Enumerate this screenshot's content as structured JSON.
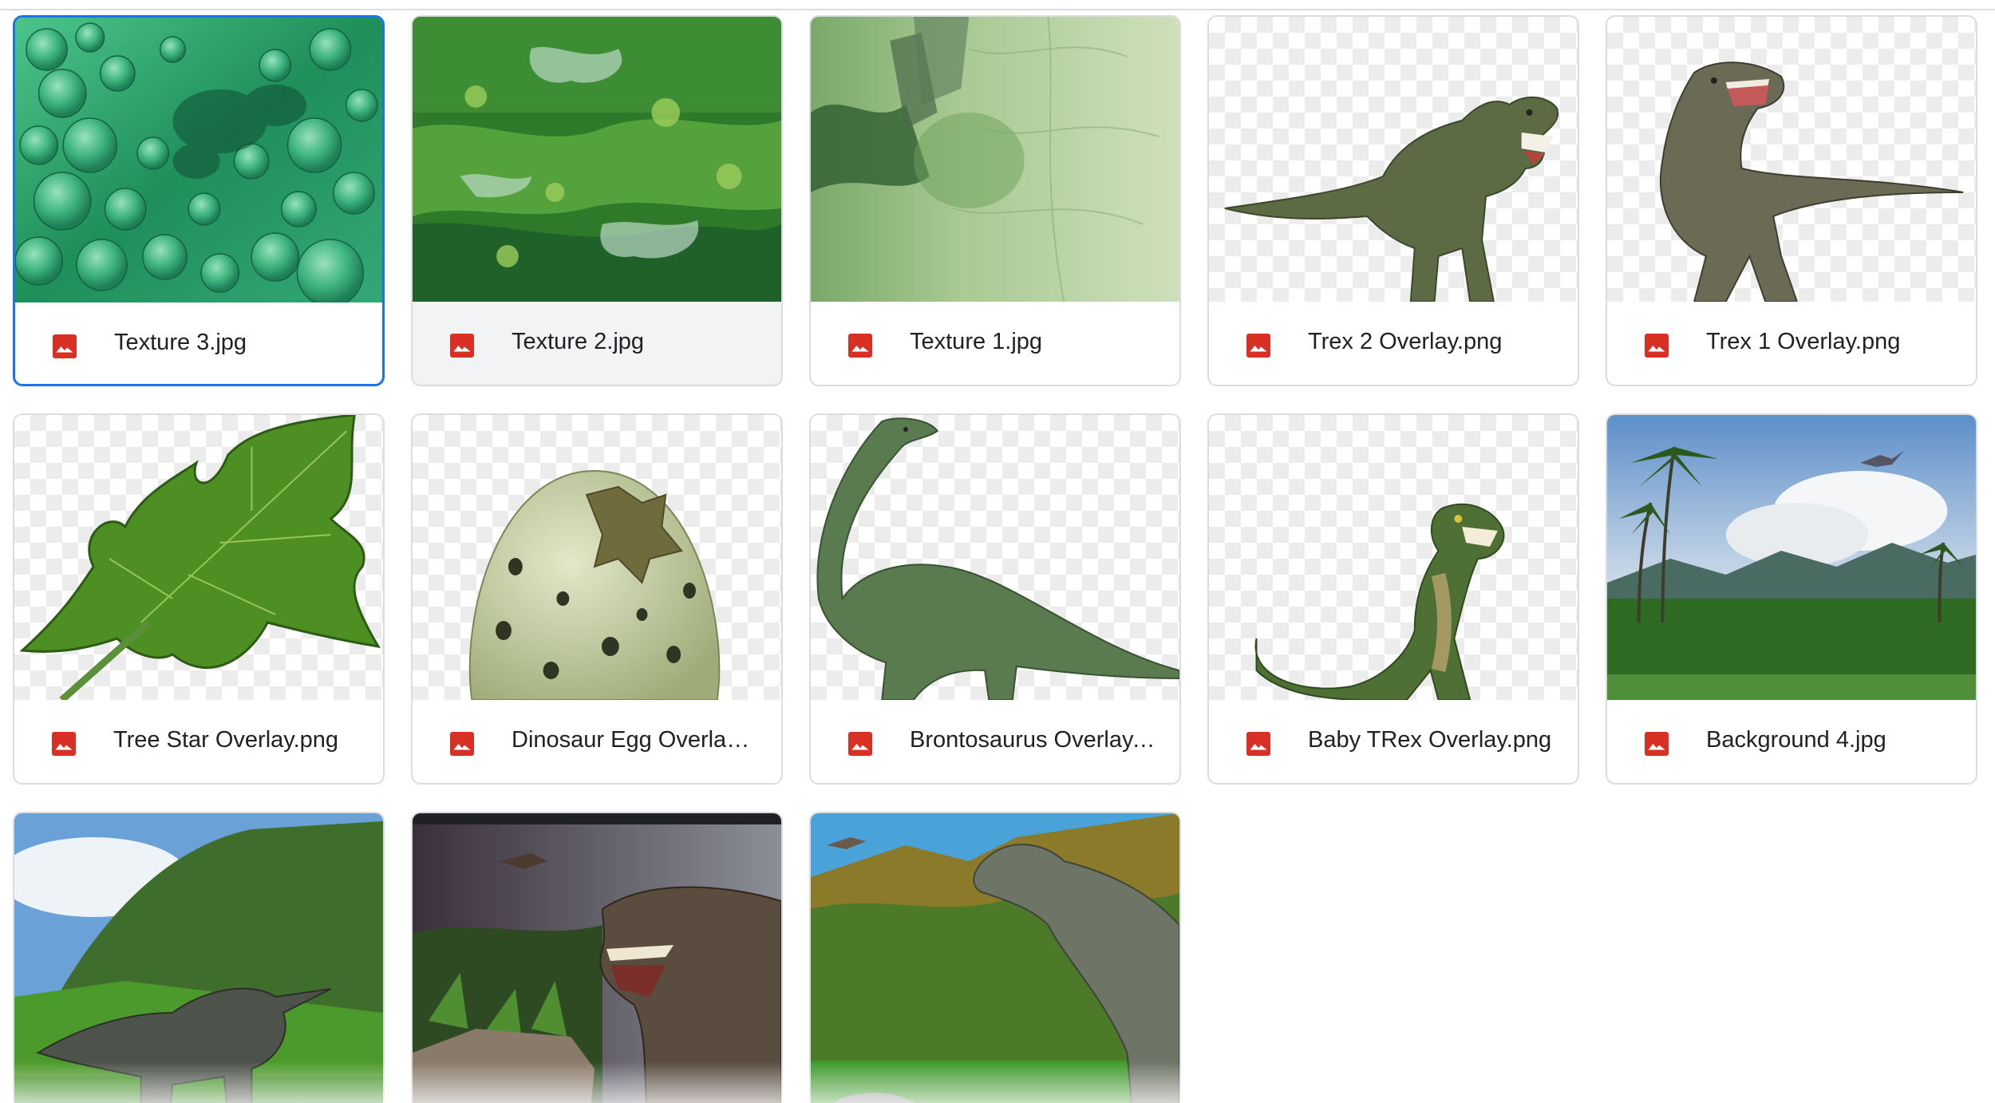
{
  "files": [
    {
      "name": "Texture 3.jpg",
      "type_icon": "image-icon",
      "state": "selected"
    },
    {
      "name": "Texture 2.jpg",
      "type_icon": "image-icon",
      "state": "hover"
    },
    {
      "name": "Texture 1.jpg",
      "type_icon": "image-icon",
      "state": "normal"
    },
    {
      "name": "Trex 2 Overlay.png",
      "type_icon": "image-icon",
      "state": "normal"
    },
    {
      "name": "Trex 1 Overlay.png",
      "type_icon": "image-icon",
      "state": "normal"
    },
    {
      "name": "Tree Star Overlay.png",
      "type_icon": "image-icon",
      "state": "normal"
    },
    {
      "name": "Dinosaur Egg Overlay....",
      "type_icon": "image-icon",
      "state": "normal"
    },
    {
      "name": "Brontosaurus Overlay....",
      "type_icon": "image-icon",
      "state": "normal"
    },
    {
      "name": "Baby TRex Overlay.png",
      "type_icon": "image-icon",
      "state": "normal"
    },
    {
      "name": "Background 4.jpg",
      "type_icon": "image-icon",
      "state": "normal"
    }
  ],
  "colors": {
    "selection_border": "#1a73e8",
    "card_border": "#dadce0",
    "hover_background": "#f1f3f4",
    "image_icon": "#d93025",
    "text": "#202124"
  }
}
